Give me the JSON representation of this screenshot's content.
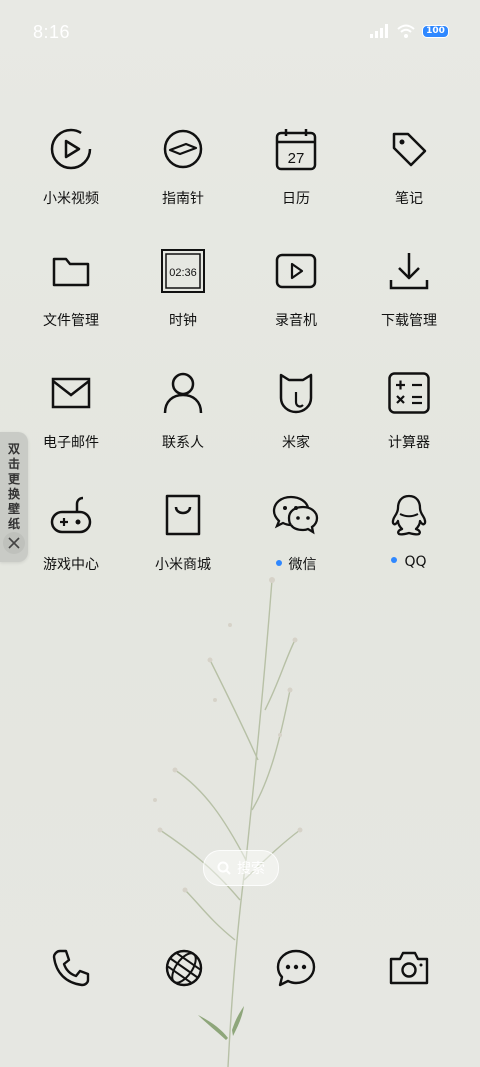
{
  "status_bar": {
    "time": "8:16",
    "battery": "100",
    "battery_color": "#2f88ff"
  },
  "apps": [
    {
      "label": "小米视频",
      "icon": "video-play-icon"
    },
    {
      "label": "指南针",
      "icon": "compass-icon"
    },
    {
      "label": "日历",
      "icon": "calendar-icon",
      "calendar_day": "27"
    },
    {
      "label": "笔记",
      "icon": "tag-icon"
    },
    {
      "label": "文件管理",
      "icon": "folder-icon"
    },
    {
      "label": "时钟",
      "icon": "clock-icon",
      "clock_time": "02:36"
    },
    {
      "label": "录音机",
      "icon": "recorder-icon"
    },
    {
      "label": "下载管理",
      "icon": "download-icon"
    },
    {
      "label": "电子邮件",
      "icon": "mail-icon"
    },
    {
      "label": "联系人",
      "icon": "contact-icon"
    },
    {
      "label": "米家",
      "icon": "mijia-icon"
    },
    {
      "label": "计算器",
      "icon": "calculator-icon"
    },
    {
      "label": "游戏中心",
      "icon": "gamepad-icon"
    },
    {
      "label": "小米商城",
      "icon": "shopping-bag-icon"
    },
    {
      "label": "微信",
      "icon": "wechat-icon",
      "new_dot": true
    },
    {
      "label": "QQ",
      "icon": "qq-penguin-icon",
      "new_dot": true
    }
  ],
  "side_tab": {
    "text": "双击更换壁纸"
  },
  "search": {
    "label": "搜索"
  },
  "dock": [
    {
      "icon": "phone-icon"
    },
    {
      "icon": "browser-globe-icon"
    },
    {
      "icon": "messages-icon"
    },
    {
      "icon": "camera-icon"
    }
  ]
}
